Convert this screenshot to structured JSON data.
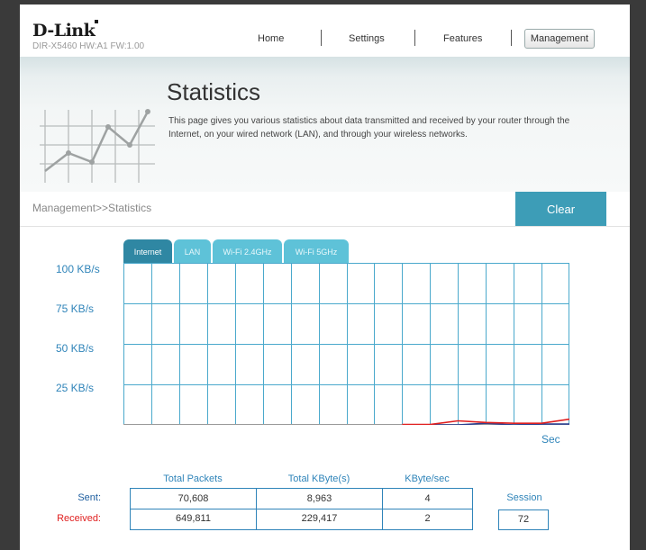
{
  "header": {
    "logo": "D-Link",
    "model": "DIR-X5460 HW:A1 FW:1.00",
    "nav": [
      "Home",
      "Settings",
      "Features",
      "Management"
    ],
    "active_nav": "Management"
  },
  "banner": {
    "title": "Statistics",
    "description": "This page gives you various statistics about data transmitted and received by your router through the Internet, on your wired network (LAN), and through your wireless networks."
  },
  "breadcrumb": "Management>>Statistics",
  "clear_label": "Clear",
  "tabs": [
    "Internet",
    "LAN",
    "Wi-Fi 2.4GHz",
    "Wi-Fi 5GHz"
  ],
  "active_tab": "Internet",
  "chart_data": {
    "type": "line",
    "xlabel": "Sec",
    "y_ticks": [
      "100 KB/s",
      "75 KB/s",
      "50 KB/s",
      "25 KB/s"
    ],
    "ylim": [
      0,
      100
    ],
    "points": 17,
    "series": [
      {
        "color": "#2b3f8f",
        "values": [
          null,
          null,
          null,
          null,
          null,
          null,
          null,
          null,
          null,
          null,
          null,
          0,
          0,
          1,
          0,
          0.5,
          0.5,
          12
        ]
      },
      {
        "color": "#e02020",
        "values": [
          null,
          null,
          null,
          null,
          null,
          null,
          null,
          null,
          null,
          null,
          0.2,
          0.2,
          2.5,
          1.5,
          1,
          1,
          3.5
        ]
      }
    ]
  },
  "stats": {
    "columns": [
      "Total Packets",
      "Total KByte(s)",
      "KByte/sec"
    ],
    "rows": [
      {
        "label": "Sent:",
        "color": "#1f5fa0",
        "values": [
          "70,608",
          "8,963",
          "4"
        ]
      },
      {
        "label": "Received:",
        "color": "#e02020",
        "values": [
          "649,811",
          "229,417",
          "2"
        ]
      }
    ],
    "session_label": "Session",
    "session_value": "72"
  }
}
